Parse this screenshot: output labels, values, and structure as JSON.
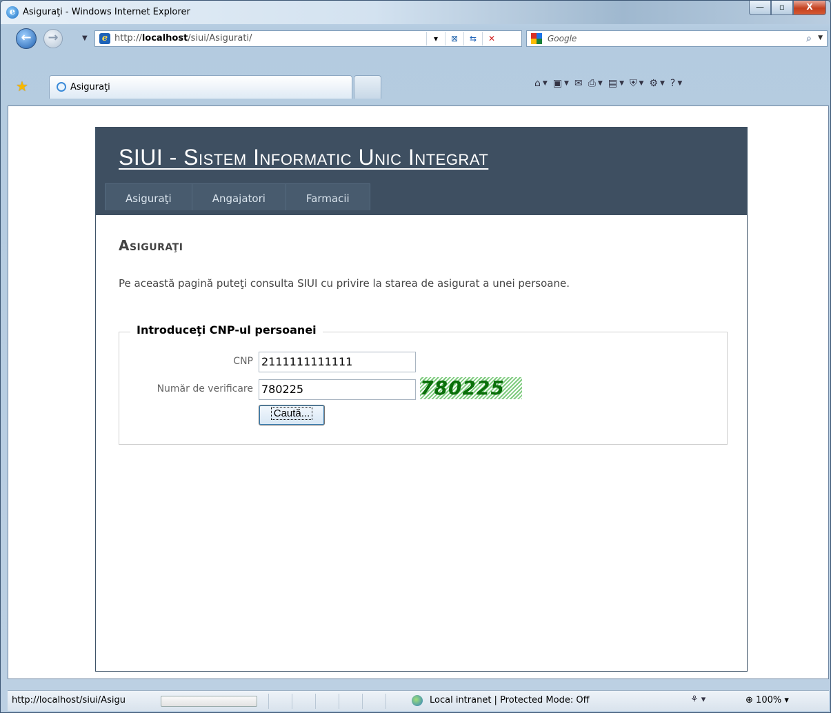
{
  "window": {
    "title": "Asiguraţi - Windows Internet Explorer",
    "buttons": {
      "minimize": "—",
      "maximize": "▫",
      "close": "X"
    }
  },
  "browser": {
    "address_prefix": "http://",
    "address_host": "localhost",
    "address_path": "/siui/Asigurati/",
    "search_placeholder": "Google",
    "tab_label": "Asiguraţi",
    "status_url": "http://localhost/siui/Asigu",
    "zone_text": "Local intranet | Protected Mode: Off",
    "zoom": "100%"
  },
  "site": {
    "title": "SIUI - Sistem Informatic Unic Integrat",
    "menu": [
      "Asiguraţi",
      "Angajatori",
      "Farmacii"
    ]
  },
  "content": {
    "heading": "Asiguraţi",
    "intro": "Pe această pagină puteţi consulta SIUI cu privire la starea de asigurat a unei persoane.",
    "fieldset_legend": "Introduceţi CNP-ul persoanei",
    "cnp_label": "CNP",
    "cnp_value": "2111111111111",
    "verif_label": "Număr de verificare",
    "verif_value": "780225",
    "captcha_text": "780225",
    "search_button": "Caută..."
  },
  "colors": {
    "header_bg": "#3e4f61",
    "menu_bg": "#485b6e",
    "captcha_green": "#0a6f0a"
  }
}
